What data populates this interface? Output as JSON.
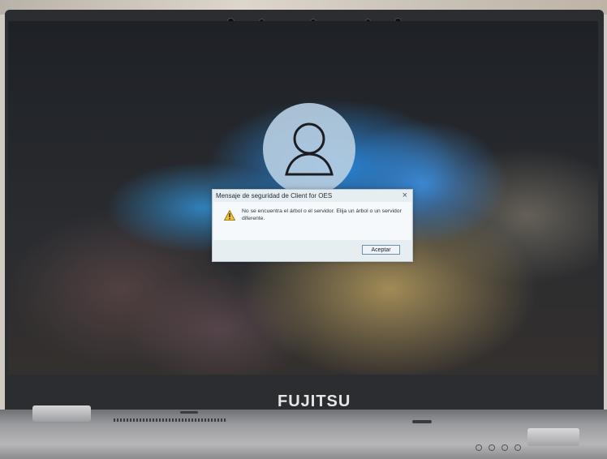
{
  "dialog": {
    "title": "Mensaje de seguridad de Client for OES",
    "close_glyph": "×",
    "message": "No se encuentra el árbol o el servidor. Elija un árbol o un servidor diferente.",
    "accept_label": "Aceptar",
    "icon": "warning-icon"
  },
  "laptop": {
    "brand": "FUJITSU"
  },
  "colors": {
    "dialog_bg": "#e7eef2",
    "button_border": "#6d8fb0",
    "warning_yellow": "#f2c230"
  }
}
